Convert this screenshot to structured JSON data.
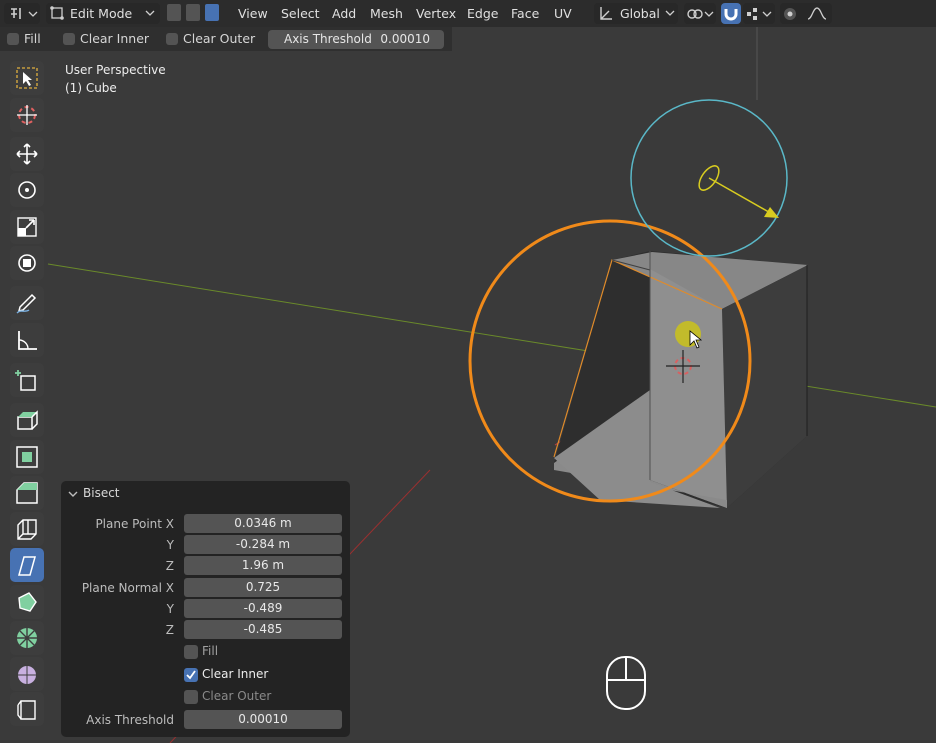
{
  "header": {
    "mode": "Edit Mode",
    "menus": [
      "View",
      "Select",
      "Add",
      "Mesh",
      "Vertex",
      "Edge",
      "Face",
      "UV"
    ],
    "transform_orientation": "Global"
  },
  "op_toolbar": {
    "fill_label": "Fill",
    "clear_inner_label": "Clear Inner",
    "clear_outer_label": "Clear Outer",
    "axis_threshold_label": "Axis Threshold",
    "axis_threshold_value": "0.00010"
  },
  "viewport": {
    "view_name": "User Perspective",
    "object_name": "(1) Cube"
  },
  "tools": [
    "select-box",
    "cursor",
    "move",
    "rotate",
    "scale",
    "transform",
    "annotate",
    "measure",
    "add-cube",
    "extrude-region",
    "inset-faces",
    "bevel",
    "loop-cut",
    "knife",
    "poly-build",
    "spin",
    "smooth",
    "shrink-fatten"
  ],
  "active_tool": "knife",
  "bisect_panel": {
    "title": "Bisect",
    "plane_point_label": "Plane Point X",
    "plane_point": [
      "0.0346 m",
      "-0.284 m",
      "1.96 m"
    ],
    "plane_normal_label": "Plane Normal X",
    "plane_normal": [
      "0.725",
      "-0.489",
      "-0.485"
    ],
    "y_label": "Y",
    "z_label": "Z",
    "fill_label": "Fill",
    "fill_checked": false,
    "clear_inner_label": "Clear Inner",
    "clear_inner_checked": true,
    "clear_outer_label": "Clear Outer",
    "clear_outer_checked": false,
    "axis_threshold_label": "Axis Threshold",
    "axis_threshold_value": "0.00010"
  },
  "colors": {
    "accent": "#4772b3",
    "gizmo_orange": "#f08a1a",
    "gizmo_cyan": "#5ab8c8",
    "gizmo_yellow": "#d8cc20"
  }
}
